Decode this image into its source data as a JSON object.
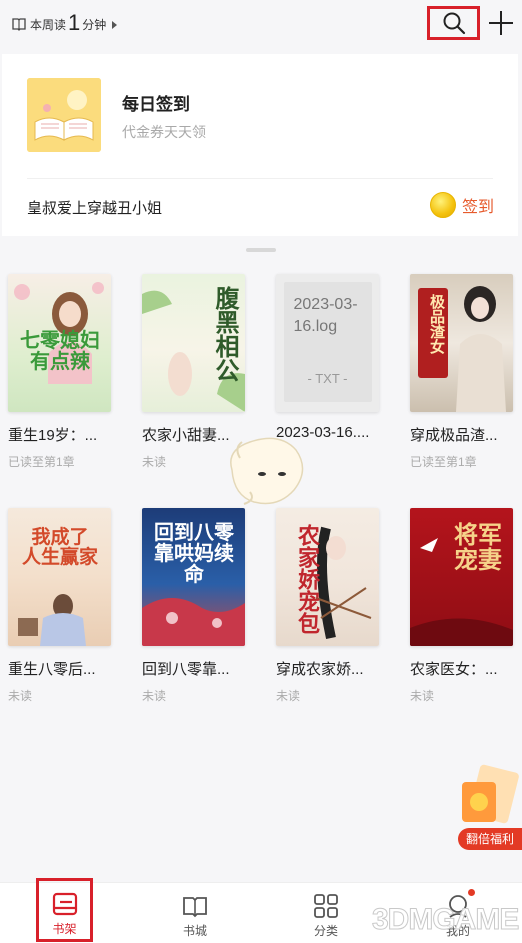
{
  "topbar": {
    "reading_prefix": "本周读",
    "reading_value": "1",
    "reading_unit": "分钟"
  },
  "checkin": {
    "title": "每日签到",
    "subtitle": "代金券天天领",
    "recommend_title": "皇叔爱上穿越丑小姐",
    "signin_label": "签到"
  },
  "books": [
    {
      "title": "重生19岁：...",
      "status": "已读至第1章",
      "cover_text": "重生19岁 七零媳妇有点辣"
    },
    {
      "title": "农家小甜妻...",
      "status": "未读",
      "cover_text": "腹黑相公"
    },
    {
      "title": "2023-03-16....",
      "status": "未读",
      "file_name": "2023-03-16.log",
      "file_ext": "- TXT -"
    },
    {
      "title": "穿成极品渣...",
      "status": "已读至第1章",
      "cover_text": "穿成极品渣女"
    },
    {
      "title": "重生八零后...",
      "status": "未读",
      "cover_text": "重生八零我成了人生赢家"
    },
    {
      "title": "回到八零靠...",
      "status": "未读",
      "cover_text": "回到八零靠哄妈续命"
    },
    {
      "title": "穿成农家娇...",
      "status": "未读",
      "cover_text": "农家娇宠包"
    },
    {
      "title": "农家医女：...",
      "status": "未读",
      "cover_text": "将军宠妻"
    }
  ],
  "promo": {
    "label": "翻倍福利"
  },
  "nav": {
    "shelf": "书架",
    "store": "书城",
    "category": "分类",
    "me": "我的"
  },
  "watermark": "3DMGAME",
  "colors": {
    "accent": "#d8202a",
    "orange": "#e65a2c",
    "coin": "#f4c20d"
  }
}
